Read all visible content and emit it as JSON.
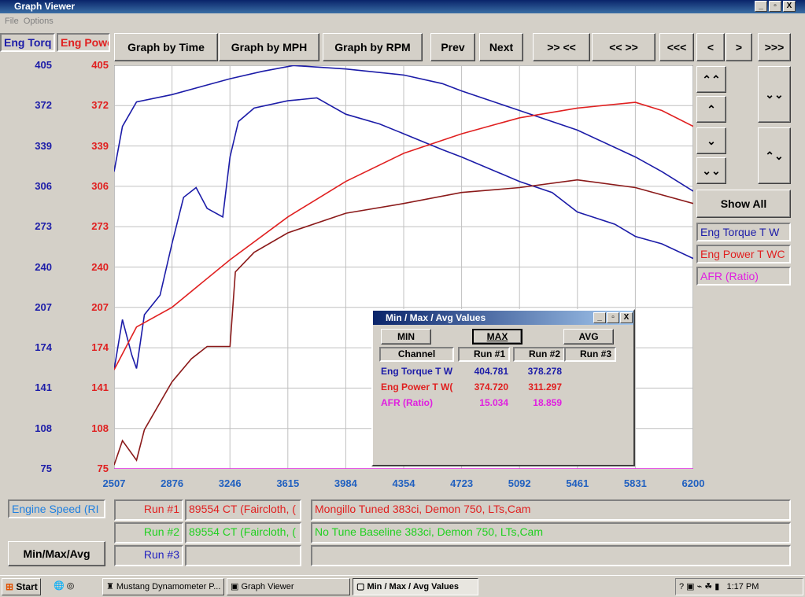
{
  "window": {
    "title": "Graph Viewer",
    "menu": [
      "File",
      "Options"
    ],
    "controls": [
      "_",
      "▫",
      "X"
    ]
  },
  "toolbar": {
    "buttons": [
      "Graph by Time",
      "Graph by MPH",
      "Graph by RPM",
      "Prev",
      "Next",
      ">> <<",
      "<< >>",
      "<<<",
      "<",
      ">",
      ">>>"
    ]
  },
  "axis_headers": {
    "left1": "Eng Torq",
    "left2": "Eng Powe"
  },
  "right_panel": {
    "show_all": "Show All",
    "channels": [
      {
        "label": "Eng Torque T W",
        "color": "#1c1ca8"
      },
      {
        "label": "Eng Power T WC",
        "color": "#e02020"
      },
      {
        "label": "AFR (Ratio)",
        "color": "#e020e0"
      }
    ]
  },
  "chart_data": {
    "type": "line",
    "grid": true,
    "x_ticks": [
      "2507",
      "2876",
      "3246",
      "3615",
      "3984",
      "4354",
      "4723",
      "5092",
      "5461",
      "5831",
      "6200"
    ],
    "y_ticks": [
      "405",
      "372",
      "339",
      "306",
      "273",
      "240",
      "207",
      "174",
      "141",
      "108",
      "75"
    ],
    "xlim": [
      2507,
      6200
    ],
    "ylim": [
      75,
      405
    ],
    "series": [
      {
        "color": "#1c1ca8",
        "x": [
          2507,
          2560,
          2650,
          2876,
          3246,
          3450,
          3650,
          3984,
          4354,
          4600,
          4723,
          5092,
          5461,
          5831,
          6000,
          6200
        ],
        "y": [
          318,
          355,
          375,
          381,
          394,
          400,
          404.8,
          402,
          397,
          390,
          384,
          368,
          352,
          330,
          318,
          302
        ]
      },
      {
        "color": "#1c1ca8",
        "x": [
          2507,
          2560,
          2620,
          2650,
          2700,
          2800,
          2876,
          2950,
          3030,
          3100,
          3200,
          3246,
          3300,
          3400,
          3615,
          3800,
          3984,
          4200,
          4354,
          4600,
          4723,
          5092,
          5300,
          5461,
          5700,
          5831,
          6000,
          6200
        ],
        "y": [
          156,
          197,
          168,
          157,
          201,
          217,
          259,
          297,
          305,
          288,
          281,
          330,
          359,
          370,
          376,
          378.3,
          365,
          357,
          349,
          336,
          330,
          310,
          301,
          285,
          275,
          265,
          259,
          247
        ]
      },
      {
        "color": "#e02020",
        "x": [
          2507,
          2650,
          2876,
          3246,
          3615,
          3984,
          4354,
          4723,
          5092,
          5461,
          5831,
          6000,
          6200
        ],
        "y": [
          156,
          191,
          207,
          246,
          281,
          310,
          333,
          349,
          362,
          370,
          374.7,
          368,
          355
        ]
      },
      {
        "color": "#8b1a1a",
        "x": [
          2507,
          2560,
          2650,
          2700,
          2876,
          3000,
          3100,
          3246,
          3280,
          3400,
          3615,
          3984,
          4354,
          4723,
          5092,
          5461,
          5831,
          6200
        ],
        "y": [
          78,
          98,
          82,
          107,
          146,
          165,
          175,
          175,
          236,
          252,
          268,
          284,
          292,
          301,
          305,
          311.3,
          305,
          292
        ]
      },
      {
        "color": "#e020e0",
        "x": [
          2507,
          6200
        ],
        "y": [
          75,
          75
        ]
      }
    ]
  },
  "minmax": {
    "title": "Min / Max / Avg Values",
    "buttons": [
      "MIN",
      "MAX",
      "AVG"
    ],
    "headers": [
      "Channel",
      "Run #1",
      "Run #2",
      "Run #3"
    ],
    "rows": [
      {
        "ch": "Eng Torque T W",
        "r1": "404.781",
        "r2": "378.278",
        "color": "#1c1ca8"
      },
      {
        "ch": "Eng Power T W(",
        "r1": "374.720",
        "r2": "311.297",
        "color": "#e02020"
      },
      {
        "ch": "AFR (Ratio)",
        "r1": "15.034",
        "r2": "18.859",
        "color": "#e020e0"
      }
    ]
  },
  "bottom": {
    "x_channel": "Engine Speed (RI",
    "minmax_button": "Min/Max/Avg",
    "runs": [
      {
        "label": "Run #1",
        "id": "89554 CT (Faircloth, (",
        "desc": "Mongillo Tuned 383ci, Demon 750, LTs,Cam",
        "color": "#e02020"
      },
      {
        "label": "Run #2",
        "id": "89554 CT (Faircloth, (",
        "desc": "No Tune Baseline 383ci, Demon 750, LTs,Cam",
        "color": "#20d020"
      },
      {
        "label": "Run #3",
        "id": "",
        "desc": "",
        "color": "#2020c0"
      }
    ]
  },
  "taskbar": {
    "start": "Start",
    "items": [
      "Mustang Dynamometer P...",
      "Graph Viewer",
      "Min / Max / Avg Values"
    ],
    "clock": "1:17 PM"
  }
}
